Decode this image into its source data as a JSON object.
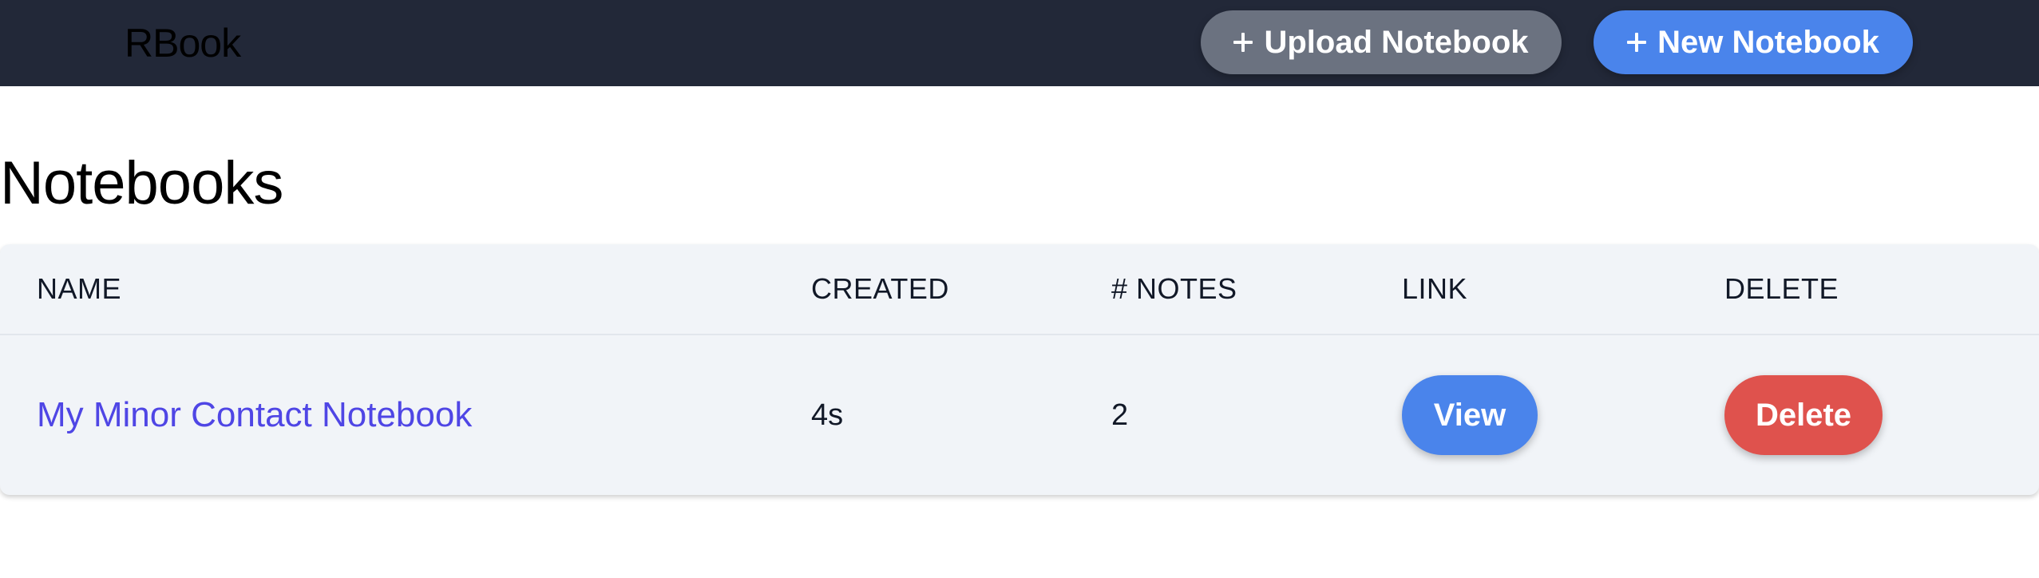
{
  "header": {
    "brand": "RBook",
    "upload_label": "Upload Notebook",
    "new_label": "New Notebook"
  },
  "page": {
    "title": "Notebooks"
  },
  "table": {
    "columns": [
      "NAME",
      "CREATED",
      "# NOTES",
      "LINK",
      "DELETE"
    ],
    "rows": [
      {
        "name": "My Minor Contact Notebook",
        "created": "4s",
        "notes": "2",
        "link_label": "View",
        "delete_label": "Delete"
      }
    ]
  },
  "colors": {
    "topbar": "#222838",
    "upload_button": "#6b7280",
    "primary": "#4a84eb",
    "danger": "#df524d",
    "link": "#4f46e5",
    "table_bg": "#f1f4f8"
  },
  "icons": {
    "upload": "plus-icon",
    "new": "plus-icon"
  }
}
